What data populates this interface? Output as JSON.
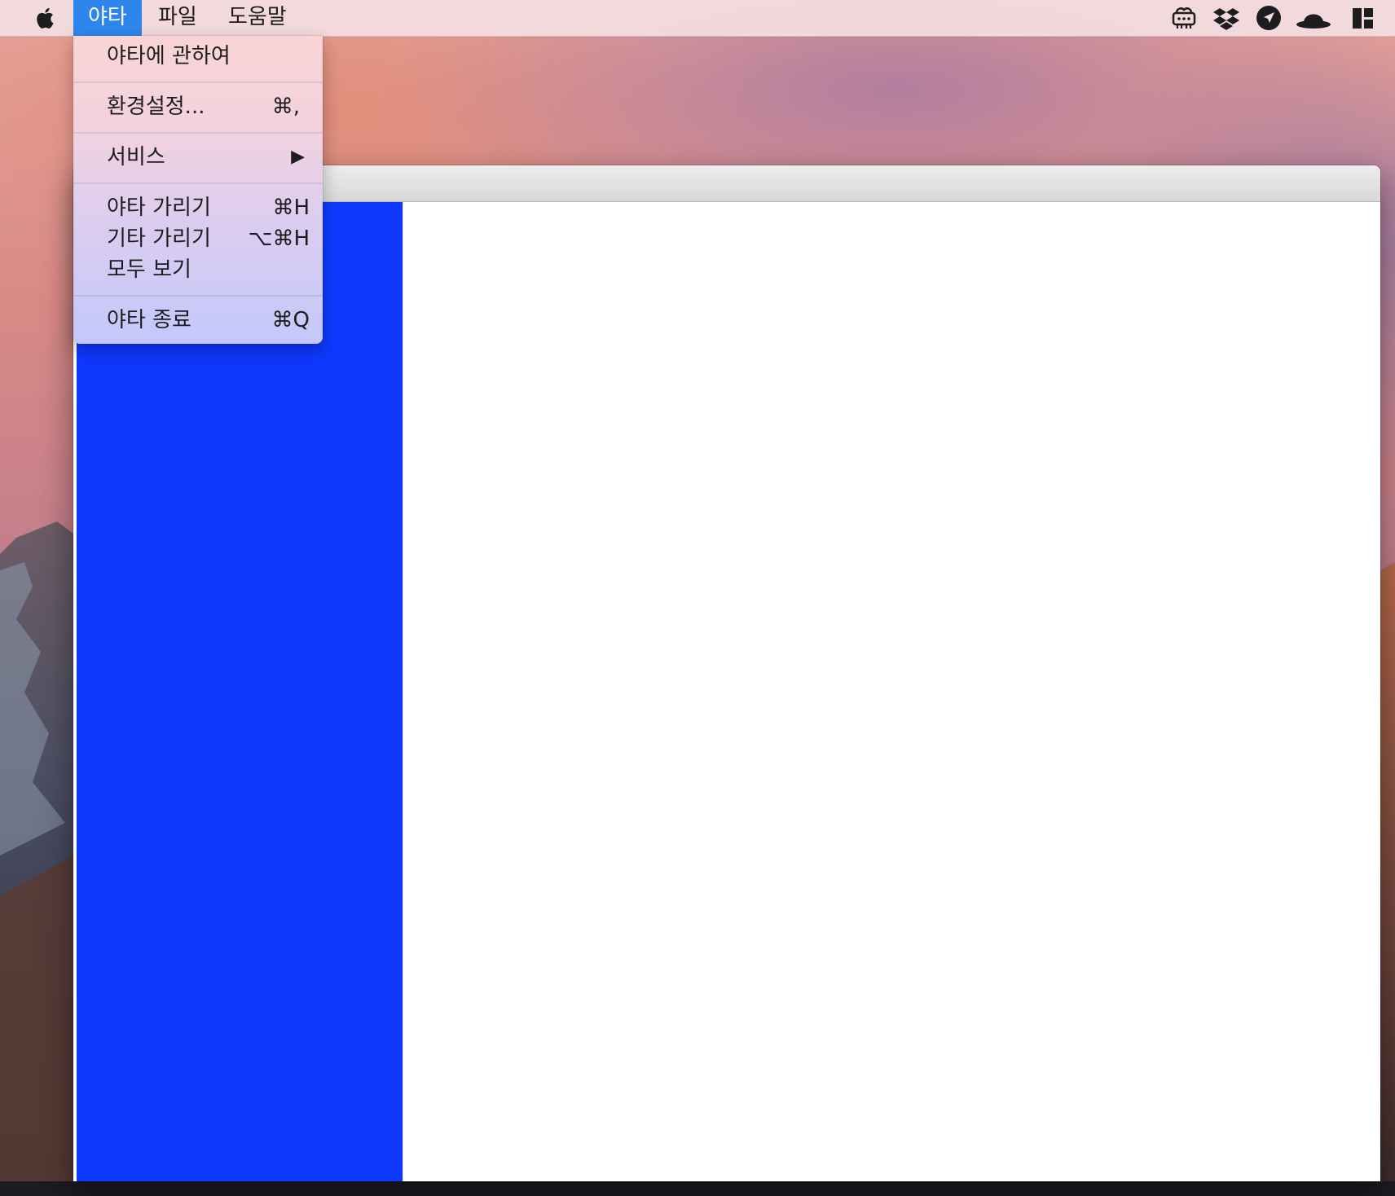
{
  "menubar": {
    "apple_icon": "apple-logo-icon",
    "menus": [
      "야타",
      "파일",
      "도움말"
    ],
    "active_menu": "야타",
    "active_color": "#2e86ec",
    "tray_icons": [
      "cloud-printer-icon",
      "dropbox-icon",
      "location-arrow-icon",
      "bowler-hat-icon",
      "layout-grid-icon"
    ]
  },
  "app_menu": {
    "items": [
      {
        "label": "야타에 관하여",
        "shortcut": ""
      },
      {
        "label": "환경설정...",
        "shortcut": "⌘,"
      },
      {
        "label": "서비스",
        "shortcut": "▶"
      },
      {
        "label": "야타 가리기",
        "shortcut": "⌘H"
      },
      {
        "label": "기타 가리기",
        "shortcut": "⌥⌘H"
      },
      {
        "label": "모두 보기",
        "shortcut": ""
      },
      {
        "label": "야타 종료",
        "shortcut": "⌘Q"
      }
    ]
  },
  "window": {
    "sidebar_color": "#0f38ff",
    "content_color": "#ffffff"
  }
}
